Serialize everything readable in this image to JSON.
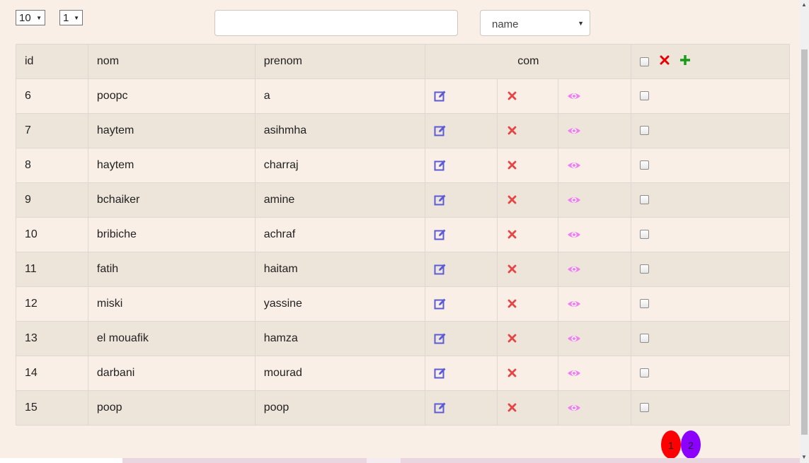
{
  "controls": {
    "page_size_value": "10",
    "page_select_value": "1",
    "search_value": "",
    "sort_value": "name"
  },
  "table": {
    "headers": {
      "id": "id",
      "nom": "nom",
      "prenom": "prenom",
      "com": "com"
    },
    "rows": [
      {
        "id": "6",
        "nom": "poopc",
        "prenom": "a"
      },
      {
        "id": "7",
        "nom": "haytem",
        "prenom": "asihmha"
      },
      {
        "id": "8",
        "nom": "haytem",
        "prenom": "charraj"
      },
      {
        "id": "9",
        "nom": "bchaiker",
        "prenom": "amine"
      },
      {
        "id": "10",
        "nom": "bribiche",
        "prenom": "achraf"
      },
      {
        "id": "11",
        "nom": "fatih",
        "prenom": "haitam"
      },
      {
        "id": "12",
        "nom": "miski",
        "prenom": "yassine"
      },
      {
        "id": "13",
        "nom": "el mouafik",
        "prenom": "hamza"
      },
      {
        "id": "14",
        "nom": "darbani",
        "prenom": "mourad"
      },
      {
        "id": "15",
        "nom": "poop",
        "prenom": "poop"
      }
    ]
  },
  "pagination": {
    "pages": [
      {
        "label": "1",
        "color": "#ff0000"
      },
      {
        "label": "2",
        "color": "#8b00ff"
      }
    ]
  },
  "icons": {
    "edit": "edit-icon",
    "delete": "delete-icon",
    "view": "eye-icon",
    "add": "add-icon"
  },
  "colors": {
    "edit": "#5b5bd6",
    "delete": "#e64545",
    "view": "#f07ff0",
    "add": "#1a9a1a",
    "header_delete": "#e60000"
  }
}
